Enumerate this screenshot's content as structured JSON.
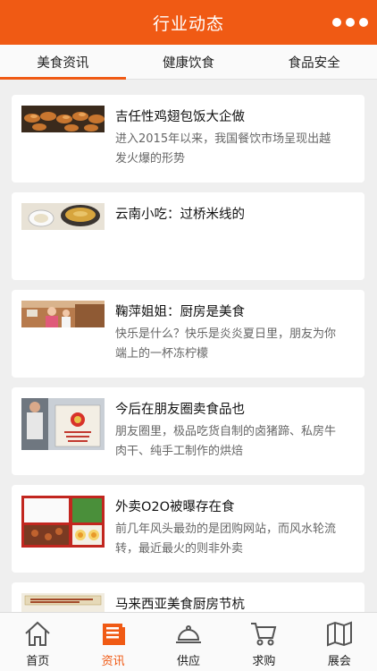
{
  "header": {
    "title": "行业动态"
  },
  "tabs": [
    {
      "label": "美食资讯"
    },
    {
      "label": "健康饮食"
    },
    {
      "label": "食品安全"
    }
  ],
  "articles": [
    {
      "title": "吉任性鸡翅包饭大企做",
      "desc": "进入2015年以来，我国餐饮市场呈现出越发火爆的形势"
    },
    {
      "title": "云南小吃：过桥米线的",
      "desc": ""
    },
    {
      "title": "鞠萍姐姐：厨房是美食",
      "desc": "快乐是什么？快乐是炎炎夏日里，朋友为你端上的一杯冻柠檬"
    },
    {
      "title": "今后在朋友圈卖食品也",
      "desc": "朋友圈里，极品吃货自制的卤猪蹄、私房牛肉干、纯手工制作的烘焙"
    },
    {
      "title": "外卖O2O被曝存在食",
      "desc": "前几年风头最劲的是团购网站，而风水轮流转，最近最火的则非外卖"
    },
    {
      "title": "马来西亚美食厨房节杭",
      "desc": ""
    }
  ],
  "bottom_nav": [
    {
      "label": "首页",
      "icon": "home-icon"
    },
    {
      "label": "资讯",
      "icon": "news-icon"
    },
    {
      "label": "供应",
      "icon": "cloche-icon"
    },
    {
      "label": "求购",
      "icon": "cart-icon"
    },
    {
      "label": "展会",
      "icon": "map-icon"
    }
  ],
  "colors": {
    "accent": "#f05a14",
    "background": "#efefef"
  }
}
